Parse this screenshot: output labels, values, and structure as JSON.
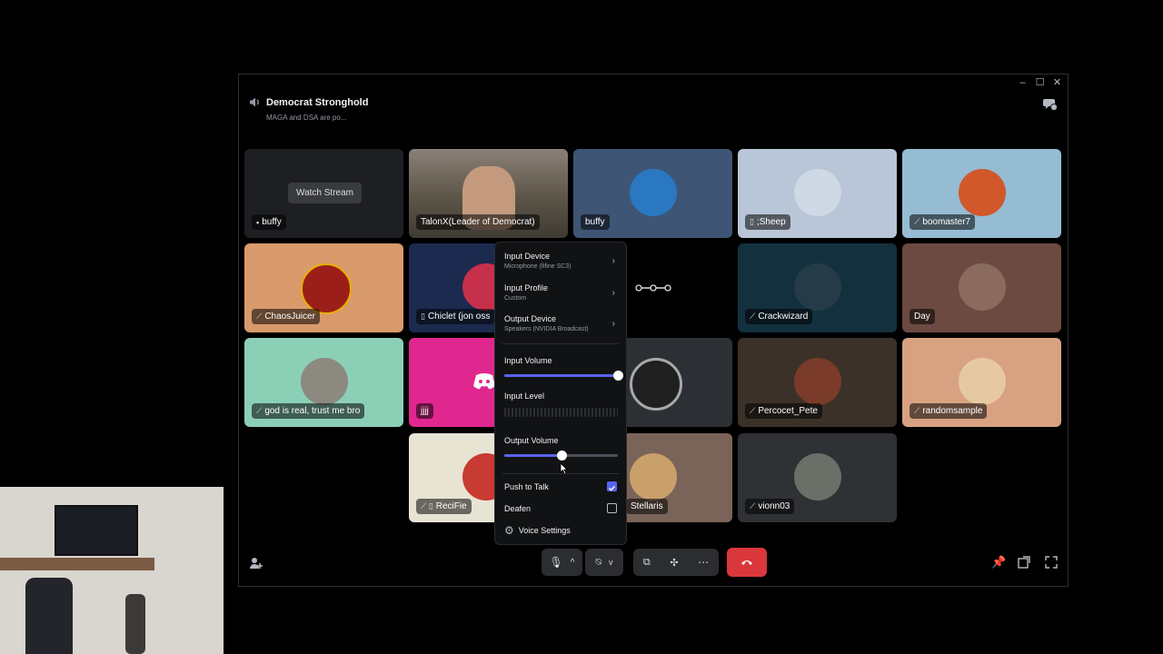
{
  "window": {
    "controls": [
      "–",
      "☐",
      "✕"
    ]
  },
  "header": {
    "title": "Democrat Stronghold",
    "subtitle": "MAGA and DSA are po..."
  },
  "tiles": [
    {
      "name": "buffy",
      "icon": "▪",
      "watch": "Watch Stream"
    },
    {
      "name": "TalonX(Leader of Democrat)"
    },
    {
      "name": "buffy"
    },
    {
      "name": ";Sheep",
      "icon": "▯"
    },
    {
      "name": "boomaster7",
      "icon": "⟋"
    },
    {
      "name": "ChaosJuicer",
      "icon": "⟋"
    },
    {
      "name": "Chiclet (jon oss",
      "icon": "▯"
    },
    {
      "name": "Crackwizard",
      "icon": "⟋"
    },
    {
      "name": "Day"
    },
    {
      "name": "god is real, trust me bro",
      "icon": "⟋"
    },
    {
      "name": "jjjj"
    },
    {
      "name": "Percocet_Pete",
      "icon": "⟋"
    },
    {
      "name": "randomsample",
      "icon": "⟋"
    },
    {
      "name": "ReciFie",
      "icon": "⟋ ▯"
    },
    {
      "name": "Stellaris"
    },
    {
      "name": "vionn03",
      "icon": "⟋"
    }
  ],
  "menu": {
    "input_device": {
      "title": "Input Device",
      "value": "Microphone (fifine SC3)"
    },
    "input_profile": {
      "title": "Input Profile",
      "value": "Custom"
    },
    "output_device": {
      "title": "Output Device",
      "value": "Speakers (NVIDIA Broadcast)"
    },
    "input_volume": {
      "label": "Input Volume",
      "value": 1.0
    },
    "input_level": {
      "label": "Input Level"
    },
    "output_volume": {
      "label": "Output Volume",
      "value": 0.5
    },
    "push_to_talk": {
      "label": "Push to Talk",
      "checked": true
    },
    "deafen": {
      "label": "Deafen",
      "checked": false
    },
    "voice_settings": {
      "label": "Voice Settings"
    }
  },
  "colors": {
    "accent": "#5865f2",
    "end_call": "#da373c"
  }
}
